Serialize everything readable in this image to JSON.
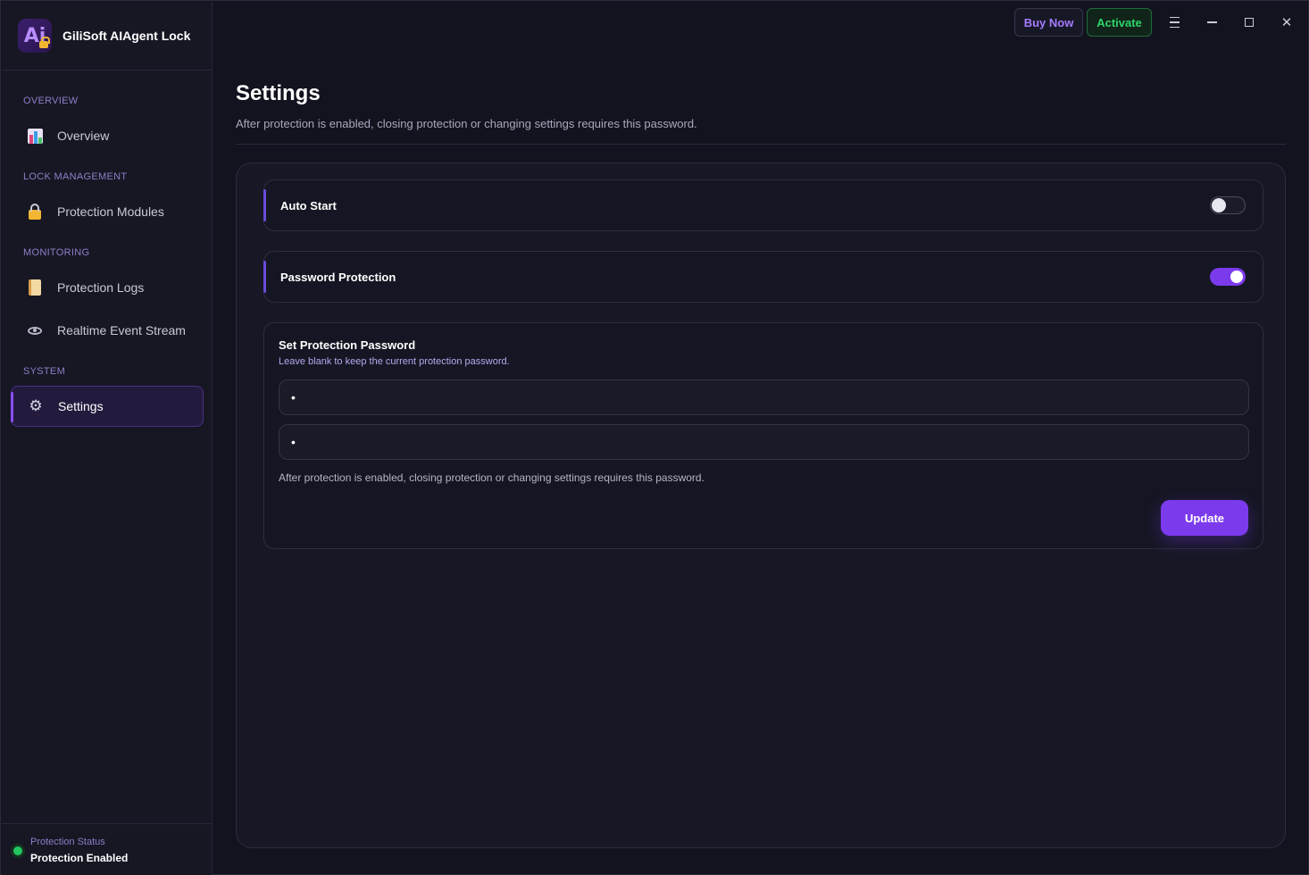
{
  "app": {
    "name": "GiliSoft AIAgent Lock",
    "logo_letters": "Ai"
  },
  "topbar": {
    "buy_label": "Buy Now",
    "activate_label": "Activate"
  },
  "sidebar": {
    "sections": [
      {
        "label": "OVERVIEW"
      },
      {
        "label": "LOCK MANAGEMENT"
      },
      {
        "label": "MONITORING"
      },
      {
        "label": "SYSTEM"
      }
    ],
    "items": [
      {
        "label": "Overview",
        "icon": "bar-chart-icon"
      },
      {
        "label": "Protection Modules",
        "icon": "lock-icon"
      },
      {
        "label": "Protection Logs",
        "icon": "scroll-icon"
      },
      {
        "label": "Realtime Event Stream",
        "icon": "eye-icon"
      },
      {
        "label": "Settings",
        "icon": "gear-icon",
        "active": true
      }
    ],
    "status": {
      "label": "Protection Status",
      "value": "Protection Enabled",
      "color": "#22c55e"
    }
  },
  "main": {
    "title": "Settings",
    "subtitle": "After protection is enabled, closing protection or changing settings requires this password.",
    "settings": [
      {
        "label": "Auto Start",
        "enabled": false
      },
      {
        "label": "Password Protection",
        "enabled": true
      }
    ],
    "password_card": {
      "title": "Set Protection Password",
      "hint": "Leave blank to keep the current protection password.",
      "field1_value": "•",
      "field2_value": "•",
      "note": "After protection is enabled, closing protection or changing settings requires this password.",
      "update_label": "Update"
    }
  },
  "colors": {
    "accent": "#7c3aed",
    "success": "#2fd36a",
    "background": "#12131f"
  }
}
